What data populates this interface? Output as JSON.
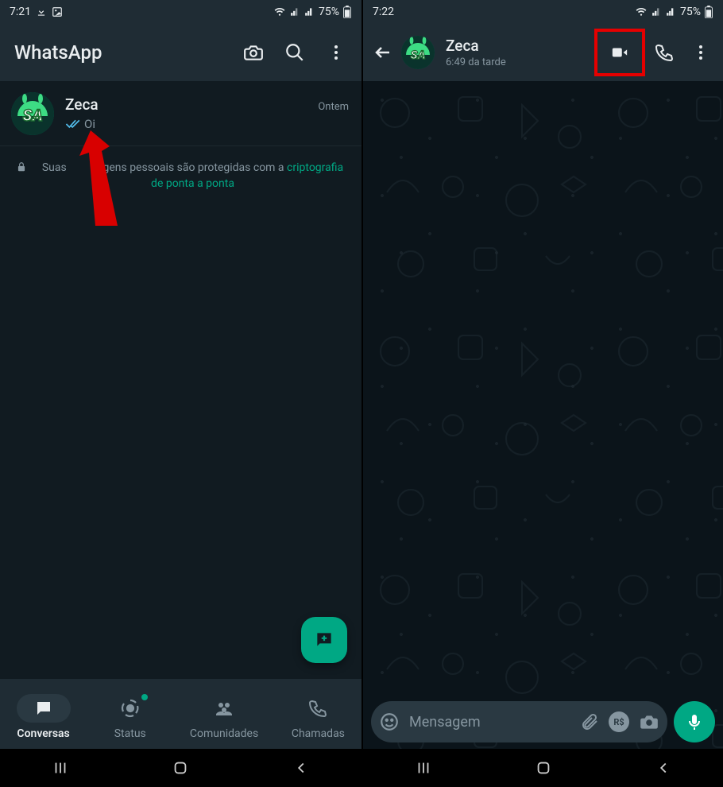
{
  "left": {
    "status": {
      "time": "7:21",
      "battery": "75%"
    },
    "app_title": "WhatsApp",
    "chat": {
      "name": "Zeca",
      "time": "Ontem",
      "message": "Oi"
    },
    "encryption": {
      "line1_a": "Suas ",
      "line1_b": "gens pessoais são protegidas com a ",
      "link": "criptografia de ponta a ponta"
    },
    "tabs": {
      "conversas": "Conversas",
      "status": "Status",
      "comunidades": "Comunidades",
      "chamadas": "Chamadas"
    }
  },
  "right": {
    "status": {
      "time": "7:22",
      "battery": "75%"
    },
    "header": {
      "name": "Zeca",
      "subtitle": "6:49 da tarde"
    },
    "input": {
      "placeholder": "Mensagem",
      "rs_label": "R$"
    }
  }
}
